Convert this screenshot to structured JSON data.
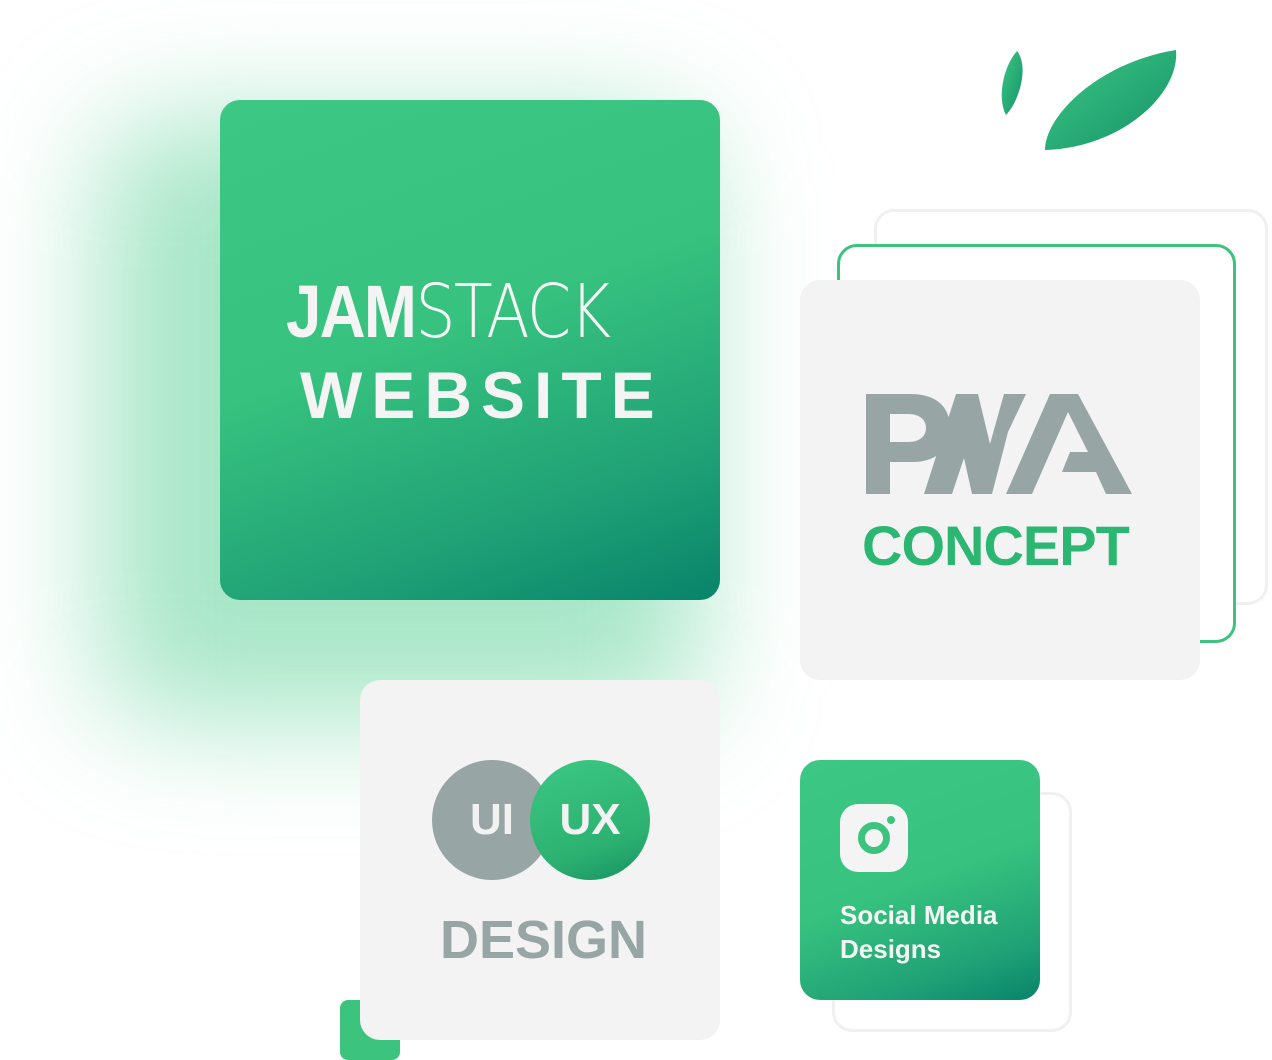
{
  "jamstack_card": {
    "word_bold": "JAM",
    "word_thin": "STACK",
    "subtitle": "WEBSITE"
  },
  "pwa_card": {
    "logo_text": "PWA",
    "subtitle": "CONCEPT"
  },
  "uiux_card": {
    "circle_left": "UI",
    "circle_right": "UX",
    "subtitle": "DESIGN"
  },
  "social_card": {
    "label": "Social Media Designs",
    "icon": "instagram-icon"
  },
  "colors": {
    "brand_green": "#3cc47f",
    "brand_green_dark": "#08836a",
    "muted_gray": "#97a5a5",
    "card_light": "#f3f3f3"
  }
}
